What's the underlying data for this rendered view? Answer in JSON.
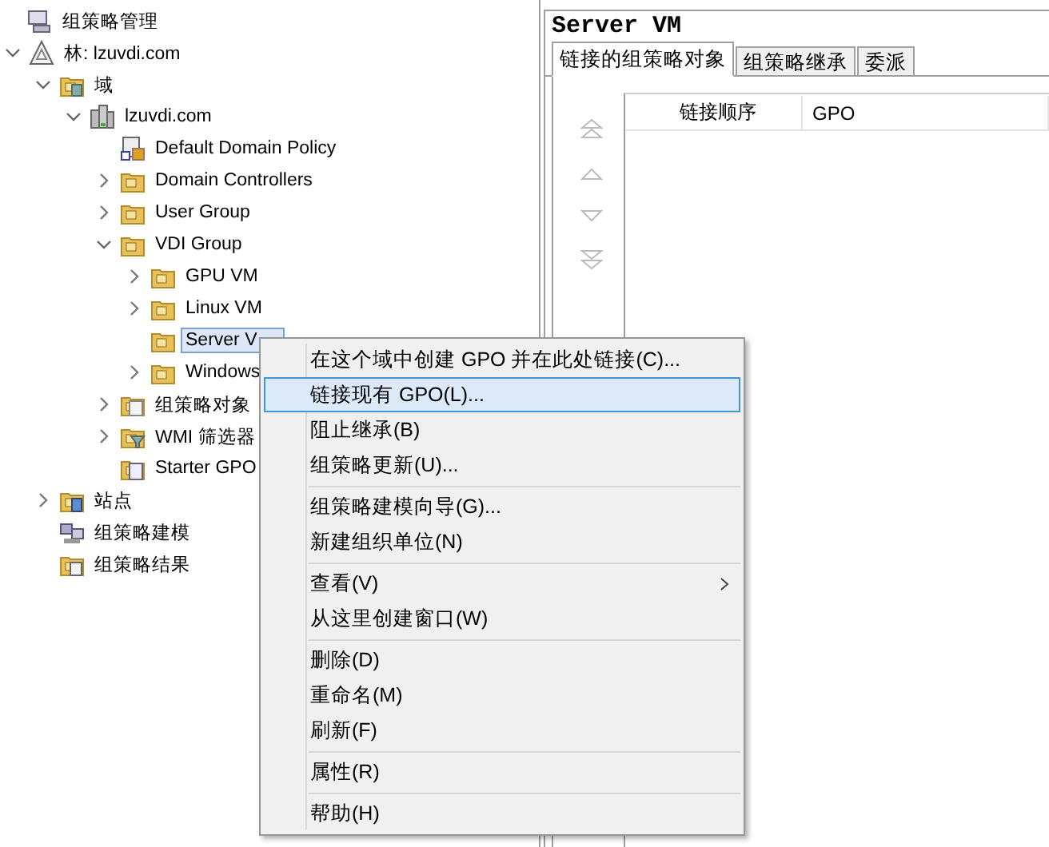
{
  "tree": [
    {
      "label": "组策略管理",
      "kind": "root",
      "selected": false,
      "children": [
        {
          "label": "林: lzuvdi.com",
          "kind": "forest",
          "expanded": true,
          "selected": false,
          "children": [
            {
              "label": "域",
              "kind": "domains",
              "expanded": true,
              "selected": false,
              "children": [
                {
                  "label": "lzuvdi.com",
                  "kind": "domain",
                  "expanded": true,
                  "selected": false,
                  "children": [
                    {
                      "label": "Default Domain Policy",
                      "kind": "gpo-link",
                      "selected": false
                    },
                    {
                      "label": "Domain Controllers",
                      "kind": "ou",
                      "expanded": false,
                      "selected": false
                    },
                    {
                      "label": "User Group",
                      "kind": "ou",
                      "expanded": false,
                      "selected": false
                    },
                    {
                      "label": "VDI Group",
                      "kind": "ou",
                      "expanded": true,
                      "selected": false,
                      "children": [
                        {
                          "label": "GPU VM",
                          "kind": "ou",
                          "expanded": false,
                          "selected": false
                        },
                        {
                          "label": "Linux VM",
                          "kind": "ou",
                          "expanded": false,
                          "selected": false
                        },
                        {
                          "label": "Server V",
                          "kind": "ou",
                          "selected": true
                        },
                        {
                          "label": "Windows",
                          "kind": "ou",
                          "expanded": false,
                          "selected": false
                        }
                      ]
                    },
                    {
                      "label": "组策略对象",
                      "kind": "gpo-folder",
                      "expanded": false,
                      "selected": false
                    },
                    {
                      "label": "WMI 筛选器",
                      "kind": "wmi",
                      "expanded": false,
                      "selected": false
                    },
                    {
                      "label": "Starter GPO",
                      "kind": "starter",
                      "selected": false
                    }
                  ]
                }
              ]
            },
            {
              "label": "站点",
              "kind": "sites",
              "expanded": false,
              "selected": false
            },
            {
              "label": "组策略建模",
              "kind": "modeling",
              "selected": false
            },
            {
              "label": "组策略结果",
              "kind": "results",
              "selected": false
            }
          ]
        }
      ]
    }
  ],
  "details": {
    "title": "Server VM",
    "tabs": [
      {
        "label": "链接的组策略对象",
        "selected": true
      },
      {
        "label": "组策略继承",
        "selected": false
      },
      {
        "label": "委派",
        "selected": false
      }
    ],
    "columns": [
      "链接顺序",
      "GPO"
    ]
  },
  "context_menu": {
    "groups": [
      [
        {
          "label": "在这个域中创建 GPO 并在此处链接(C)...",
          "highlighted": false,
          "submenu": false
        },
        {
          "label": "链接现有 GPO(L)...",
          "highlighted": true,
          "submenu": false
        },
        {
          "label": "阻止继承(B)",
          "highlighted": false,
          "submenu": false
        },
        {
          "label": "组策略更新(U)...",
          "highlighted": false,
          "submenu": false
        }
      ],
      [
        {
          "label": "组策略建模向导(G)...",
          "highlighted": false,
          "submenu": false
        },
        {
          "label": "新建组织单位(N)",
          "highlighted": false,
          "submenu": false
        }
      ],
      [
        {
          "label": "查看(V)",
          "highlighted": false,
          "submenu": true
        },
        {
          "label": "从这里创建窗口(W)",
          "highlighted": false,
          "submenu": false
        }
      ],
      [
        {
          "label": "删除(D)",
          "highlighted": false,
          "submenu": false
        },
        {
          "label": "重命名(M)",
          "highlighted": false,
          "submenu": false
        },
        {
          "label": "刷新(F)",
          "highlighted": false,
          "submenu": false
        }
      ],
      [
        {
          "label": "属性(R)",
          "highlighted": false,
          "submenu": false
        }
      ],
      [
        {
          "label": "帮助(H)",
          "highlighted": false,
          "submenu": false
        }
      ]
    ]
  }
}
